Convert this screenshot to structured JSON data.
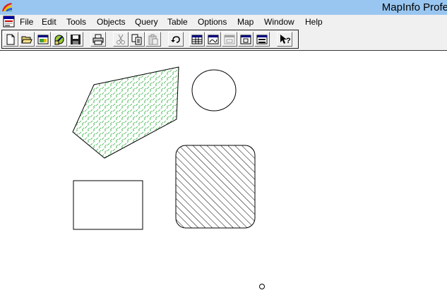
{
  "window": {
    "title": "MapInfo Profe"
  },
  "menu": {
    "items": [
      {
        "label": "File"
      },
      {
        "label": "Edit"
      },
      {
        "label": "Tools"
      },
      {
        "label": "Objects"
      },
      {
        "label": "Query"
      },
      {
        "label": "Table"
      },
      {
        "label": "Options"
      },
      {
        "label": "Map"
      },
      {
        "label": "Window"
      },
      {
        "label": "Help"
      }
    ]
  },
  "toolbar": {
    "buttons": [
      {
        "icon": "new-document-icon",
        "enabled": true
      },
      {
        "icon": "open-folder-icon",
        "enabled": true
      },
      {
        "icon": "open-workspace-icon",
        "enabled": true
      },
      {
        "icon": "open-dbms-table-icon",
        "enabled": true
      },
      {
        "icon": "save-icon",
        "enabled": true
      },
      {
        "icon": "print-icon",
        "enabled": true
      },
      {
        "icon": "cut-icon",
        "enabled": false
      },
      {
        "icon": "copy-icon",
        "enabled": true
      },
      {
        "icon": "paste-icon",
        "enabled": false
      },
      {
        "icon": "undo-icon",
        "enabled": true
      },
      {
        "icon": "new-browser-icon",
        "enabled": true
      },
      {
        "icon": "new-mapper-icon",
        "enabled": true
      },
      {
        "icon": "new-grapher-icon",
        "enabled": false
      },
      {
        "icon": "new-layout-icon",
        "enabled": true
      },
      {
        "icon": "new-redistrict-icon",
        "enabled": true
      },
      {
        "icon": "help-pointer-icon",
        "enabled": true
      },
      {
        "label": "?"
      }
    ]
  },
  "colors": {
    "titlebar": "#99c6f0",
    "chrome": "#f0f0f0",
    "polygon_fill_pattern": "#3cb44b",
    "hatch": "#000000"
  },
  "map": {
    "objects": [
      {
        "type": "polygon",
        "fill": "green dashed pattern"
      },
      {
        "type": "ellipse",
        "fill": "none"
      },
      {
        "type": "rounded-rectangle",
        "fill": "diagonal hatch"
      },
      {
        "type": "rectangle",
        "fill": "none"
      },
      {
        "type": "point",
        "symbol": "circle"
      }
    ]
  }
}
